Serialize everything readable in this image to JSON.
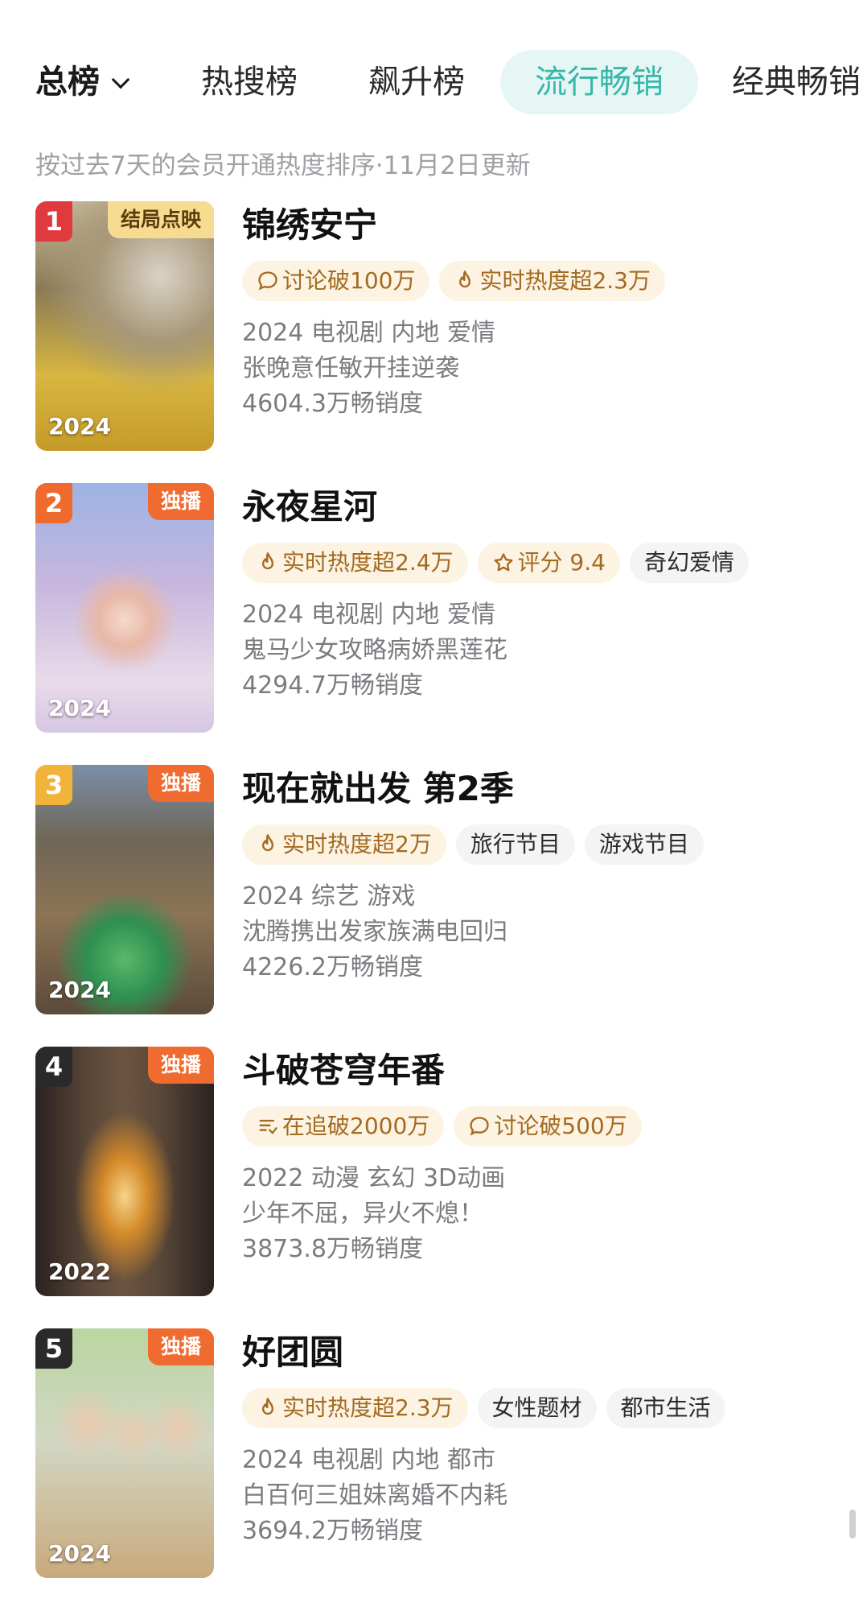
{
  "tabs": [
    {
      "label": "总榜"
    },
    {
      "label": "热搜榜"
    },
    {
      "label": "飙升榜"
    },
    {
      "label": "流行畅销"
    },
    {
      "label": "经典畅销"
    }
  ],
  "subtitle": "按过去7天的会员开通热度排序·11月2日更新",
  "items": [
    {
      "rank": "1",
      "ribbon": "结局点映",
      "year": "2024",
      "title": "锦绣安宁",
      "tags": [
        {
          "icon": "comment-icon",
          "text": "讨论破100万"
        },
        {
          "icon": "flame-icon",
          "text": "实时热度超2.3万"
        }
      ],
      "meta": "2024 电视剧 内地 爱情",
      "desc": "张晚意任敏开挂逆袭",
      "sales": "4604.3万畅销度"
    },
    {
      "rank": "2",
      "ribbon": "独播",
      "year": "2024",
      "title": "永夜星河",
      "tags": [
        {
          "icon": "flame-icon",
          "text": "实时热度超2.4万"
        },
        {
          "icon": "star-icon",
          "text": "评分 9.4"
        },
        {
          "icon": "",
          "text": "奇幻爱情"
        }
      ],
      "meta": "2024 电视剧 内地 爱情",
      "desc": "鬼马少女攻略病娇黑莲花",
      "sales": "4294.7万畅销度"
    },
    {
      "rank": "3",
      "ribbon": "独播",
      "year": "2024",
      "title": "现在就出发 第2季",
      "tags": [
        {
          "icon": "flame-icon",
          "text": "实时热度超2万"
        },
        {
          "icon": "",
          "text": "旅行节目"
        },
        {
          "icon": "",
          "text": "游戏节目"
        }
      ],
      "meta": "2024 综艺 游戏",
      "desc": "沈腾携出发家族满电回归",
      "sales": "4226.2万畅销度"
    },
    {
      "rank": "4",
      "ribbon": "独播",
      "year": "2022",
      "title": "斗破苍穹年番",
      "tags": [
        {
          "icon": "list-icon",
          "text": "在追破2000万"
        },
        {
          "icon": "comment-icon",
          "text": "讨论破500万"
        }
      ],
      "meta": "2022 动漫 玄幻 3D动画",
      "desc": "少年不屈，异火不熄！",
      "sales": "3873.8万畅销度"
    },
    {
      "rank": "5",
      "ribbon": "独播",
      "year": "2024",
      "title": "好团圆",
      "tags": [
        {
          "icon": "flame-icon",
          "text": "实时热度超2.3万"
        },
        {
          "icon": "",
          "text": "女性题材"
        },
        {
          "icon": "",
          "text": "都市生活"
        }
      ],
      "meta": "2024 电视剧 内地 都市",
      "desc": "白百何三姐妹离婚不内耗",
      "sales": "3694.2万畅销度"
    }
  ],
  "colors": {
    "active_tab_text": "#37b7a8",
    "active_tab_bg": "#e5f6f4",
    "hot_tag_bg": "#fdf3e2",
    "hot_tag_text": "#a36a22",
    "rank1": "#e0393e",
    "rank2": "#ef6a2d",
    "rank3": "#f2b33b",
    "rank_other": "#2a2a2a"
  }
}
